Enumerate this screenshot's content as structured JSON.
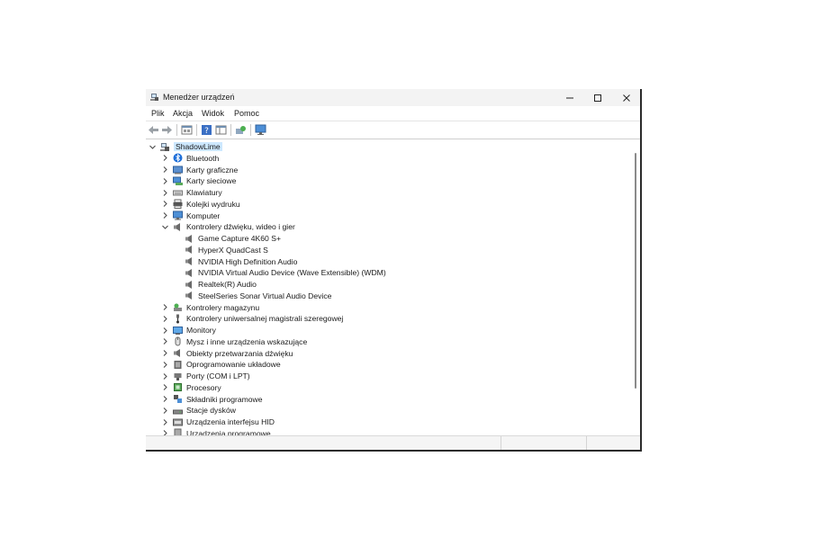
{
  "window": {
    "title": "Menedżer urządzeń"
  },
  "menu": [
    "Plik",
    "Akcja",
    "Widok",
    "Pomoc"
  ],
  "toolbar": [
    "back-arrow-icon",
    "forward-arrow-icon",
    "properties-pane-icon",
    "help-icon",
    "view-pane-icon",
    "scan-hardware-icon",
    "monitor-icon"
  ],
  "tree": {
    "root": "ShadowLime",
    "categories": [
      {
        "label": "Bluetooth",
        "icon": "bluetooth-icon"
      },
      {
        "label": "Karty graficzne",
        "icon": "display-adapter-icon"
      },
      {
        "label": "Karty sieciowe",
        "icon": "network-adapter-icon"
      },
      {
        "label": "Klawiatury",
        "icon": "keyboard-icon"
      },
      {
        "label": "Kolejki wydruku",
        "icon": "printer-icon"
      },
      {
        "label": "Komputer",
        "icon": "computer-icon"
      },
      {
        "label": "Kontrolery dźwięku, wideo i gier",
        "icon": "speaker-icon",
        "expanded": true,
        "children": [
          "Game Capture 4K60 S+",
          "HyperX QuadCast S",
          "NVIDIA High Definition Audio",
          "NVIDIA Virtual Audio Device (Wave Extensible) (WDM)",
          "Realtek(R) Audio",
          "SteelSeries Sonar Virtual Audio Device"
        ]
      },
      {
        "label": "Kontrolery magazynu",
        "icon": "storage-controller-icon"
      },
      {
        "label": "Kontrolery uniwersalnej magistrali szeregowej",
        "icon": "usb-icon"
      },
      {
        "label": "Monitory",
        "icon": "monitor-icon"
      },
      {
        "label": "Mysz i inne urządzenia wskazujące",
        "icon": "mouse-icon"
      },
      {
        "label": "Obiekty przetwarzania dźwięku",
        "icon": "audio-processing-icon"
      },
      {
        "label": "Oprogramowanie układowe",
        "icon": "firmware-icon"
      },
      {
        "label": "Porty (COM i LPT)",
        "icon": "port-icon"
      },
      {
        "label": "Procesory",
        "icon": "processor-icon"
      },
      {
        "label": "Składniki programowe",
        "icon": "software-component-icon"
      },
      {
        "label": "Stacje dysków",
        "icon": "disk-drive-icon"
      },
      {
        "label": "Urządzenia interfejsu HID",
        "icon": "hid-icon"
      },
      {
        "label": "Urządzenia programowe",
        "icon": "software-device-icon"
      }
    ]
  }
}
